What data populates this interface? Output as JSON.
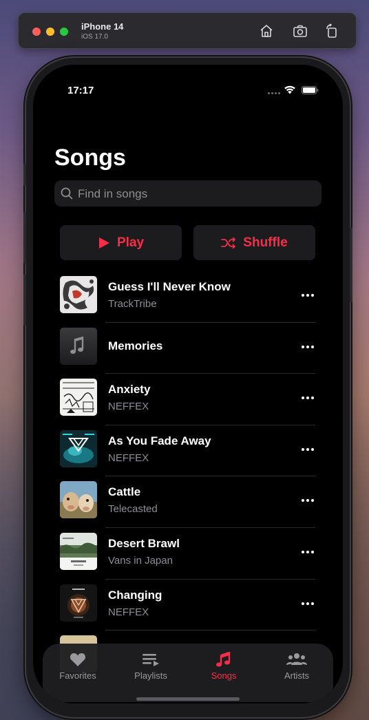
{
  "simulator": {
    "device_name": "iPhone 14",
    "os_version": "iOS 17.0",
    "icons": [
      "home-icon",
      "screenshot-icon",
      "rotate-icon"
    ]
  },
  "status_bar": {
    "time": "17:17",
    "icons": [
      "wifi-icon",
      "battery-icon"
    ]
  },
  "page": {
    "title": "Songs"
  },
  "search": {
    "placeholder": "Find in songs",
    "value": ""
  },
  "actions": {
    "play_label": "Play",
    "shuffle_label": "Shuffle"
  },
  "songs": [
    {
      "title": "Guess I'll Never Know",
      "artist": "TrackTribe"
    },
    {
      "title": "Memories",
      "artist": ""
    },
    {
      "title": "Anxiety",
      "artist": "NEFFEX"
    },
    {
      "title": "As You Fade Away",
      "artist": "NEFFEX"
    },
    {
      "title": "Cattle",
      "artist": "Telecasted"
    },
    {
      "title": "Desert Brawl",
      "artist": "Vans in Japan"
    },
    {
      "title": "Changing",
      "artist": "NEFFEX"
    }
  ],
  "tabs": [
    {
      "label": "Favorites",
      "icon": "heart-icon",
      "active": false
    },
    {
      "label": "Playlists",
      "icon": "playlist-icon",
      "active": false
    },
    {
      "label": "Songs",
      "icon": "music-note-icon",
      "active": true
    },
    {
      "label": "Artists",
      "icon": "people-icon",
      "active": false
    }
  ],
  "colors": {
    "accent": "#fa2d48",
    "background": "#000000",
    "secondary_text": "#8e8e93"
  }
}
